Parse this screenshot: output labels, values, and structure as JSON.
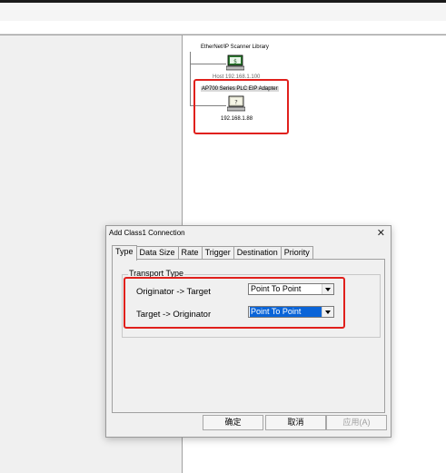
{
  "network": {
    "root_label": "EtherNet/IP Scanner Library",
    "scanner_ip_label": "Host 192.168.1.100",
    "adapter_label": "AP700 Series PLC EIP Adapter",
    "adapter_ip_label": "192.168.1.88"
  },
  "dialog": {
    "title": "Add Class1 Connection",
    "tabs": [
      "Type",
      "Data Size",
      "Rate",
      "Trigger",
      "Destination",
      "Priority"
    ],
    "active_tab": "Type",
    "group_label": "Transport Type",
    "originator_target_label": "Originator -> Target",
    "originator_target_value": "Point To Point",
    "target_originator_label": "Target -> Originator",
    "target_originator_value": "Point To Point",
    "ok_label": "确定",
    "cancel_label": "取消",
    "apply_label": "应用(A)"
  },
  "colors": {
    "highlight": "#e0201c",
    "selection": "#0a64d8"
  }
}
